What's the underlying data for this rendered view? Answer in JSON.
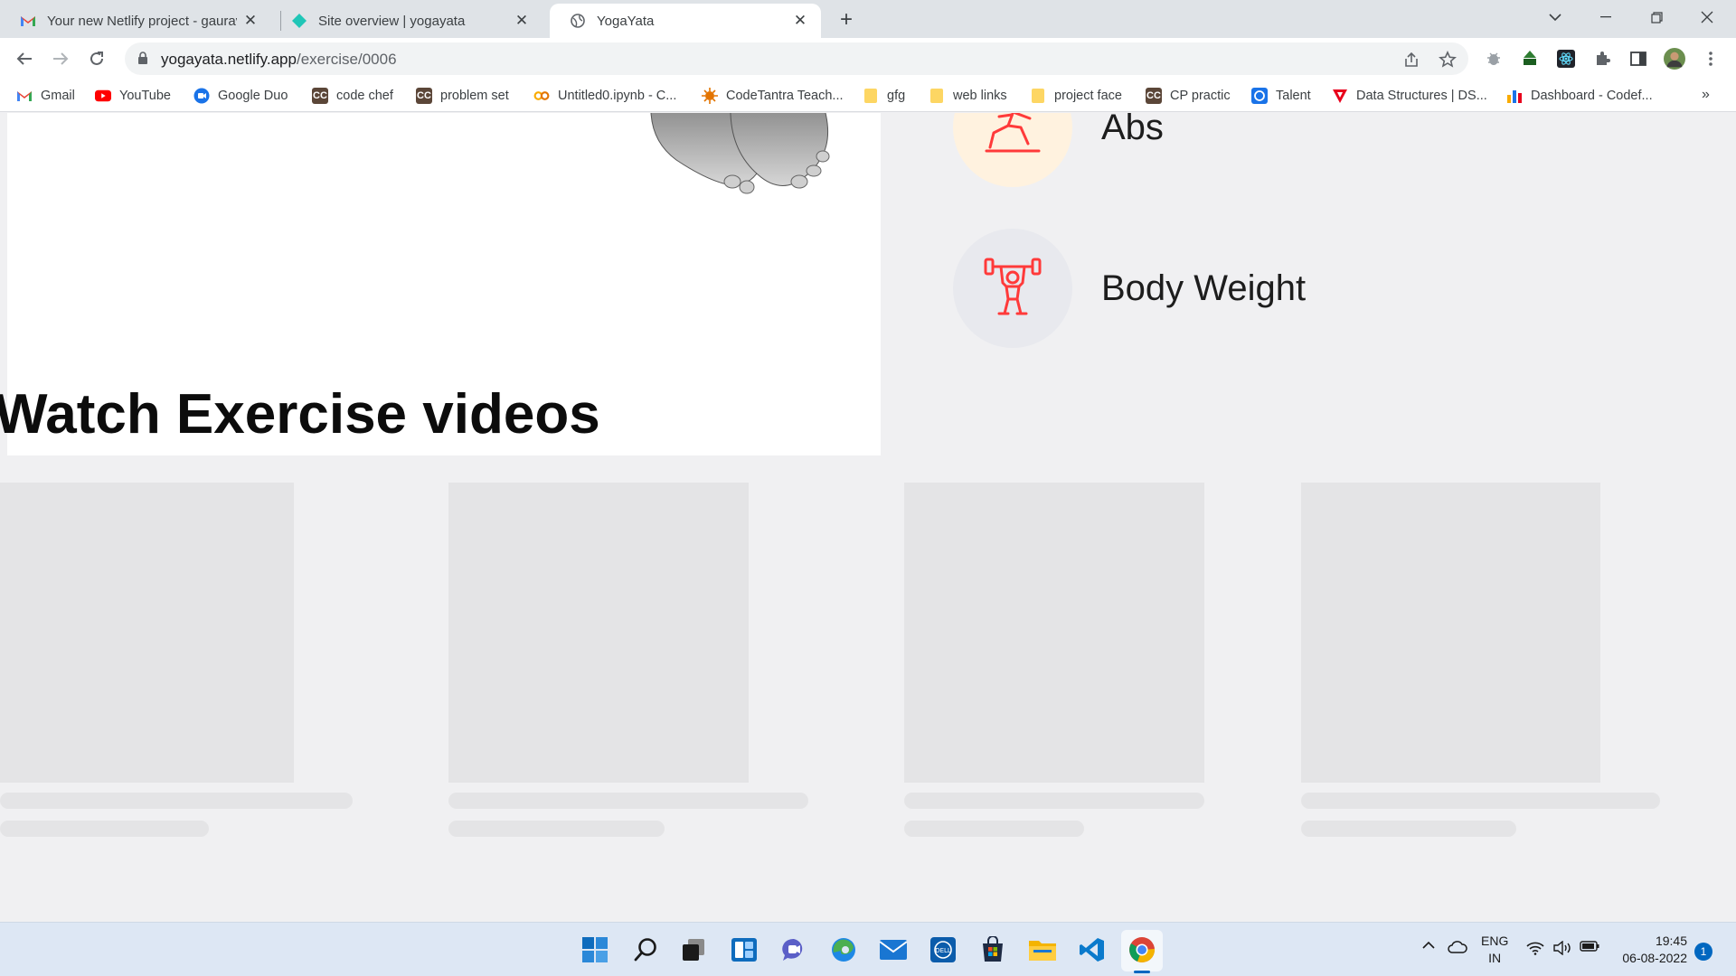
{
  "browser": {
    "tabs": [
      {
        "title": "Your new Netlify project - gaurav",
        "icon": "gmail-icon"
      },
      {
        "title": "Site overview | yogayata",
        "icon": "netlify-icon"
      },
      {
        "title": "YogaYata",
        "icon": "globe-icon",
        "active": true
      }
    ],
    "url_host": "yogayata.netlify.app",
    "url_path": "/exercise/0006",
    "bookmarks": [
      {
        "label": "Gmail",
        "icon": "gmail-icon",
        "color": "#ea4335"
      },
      {
        "label": "YouTube",
        "icon": "youtube-icon",
        "color": "#ff0000"
      },
      {
        "label": "Google Duo",
        "icon": "duo-icon",
        "color": "#1a73e8"
      },
      {
        "label": "code chef",
        "icon": "codechef-icon",
        "color": "#5b4638"
      },
      {
        "label": "problem set",
        "icon": "codechef-icon",
        "color": "#5b4638"
      },
      {
        "label": "Untitled0.ipynb - C...",
        "icon": "colab-icon",
        "color": "#f9ab00"
      },
      {
        "label": "CodeTantra Teach...",
        "icon": "codetantra-icon",
        "color": "#e37400"
      },
      {
        "label": "gfg",
        "icon": "folder-icon",
        "color": "#fdd663"
      },
      {
        "label": "web links",
        "icon": "folder-icon",
        "color": "#fdd663"
      },
      {
        "label": "project face",
        "icon": "folder-icon",
        "color": "#fdd663"
      },
      {
        "label": "CP practic",
        "icon": "codechef-icon",
        "color": "#5b4638"
      },
      {
        "label": "Talent",
        "icon": "talent-icon",
        "color": "#1a73e8"
      },
      {
        "label": "Data Structures | DS...",
        "icon": "tutorial-icon",
        "color": "#e8001c"
      },
      {
        "label": "Dashboard - Codef...",
        "icon": "codeforces-icon",
        "color": "#1a73e8"
      }
    ],
    "bookmarks_more": "»"
  },
  "page": {
    "categories": [
      {
        "label": "Abs",
        "icon": "lunge-icon",
        "bg": "#fff2df"
      },
      {
        "label": "Body Weight",
        "icon": "weightlifter-icon",
        "bg": "#e8e9ee"
      }
    ],
    "section_title": "Watch Exercise videos",
    "accent_color": "#ff3a3a",
    "video_placeholders": 4
  },
  "taskbar": {
    "apps": [
      "start-icon",
      "search-icon",
      "task-view-icon",
      "widgets-icon",
      "teams-icon",
      "edge-icon",
      "mail-icon",
      "dell-icon",
      "store-icon",
      "file-explorer-icon",
      "vscode-icon",
      "chrome-icon"
    ],
    "lang_line1": "ENG",
    "lang_line2": "IN",
    "time": "19:45",
    "date": "06-08-2022",
    "notifications": "1"
  }
}
